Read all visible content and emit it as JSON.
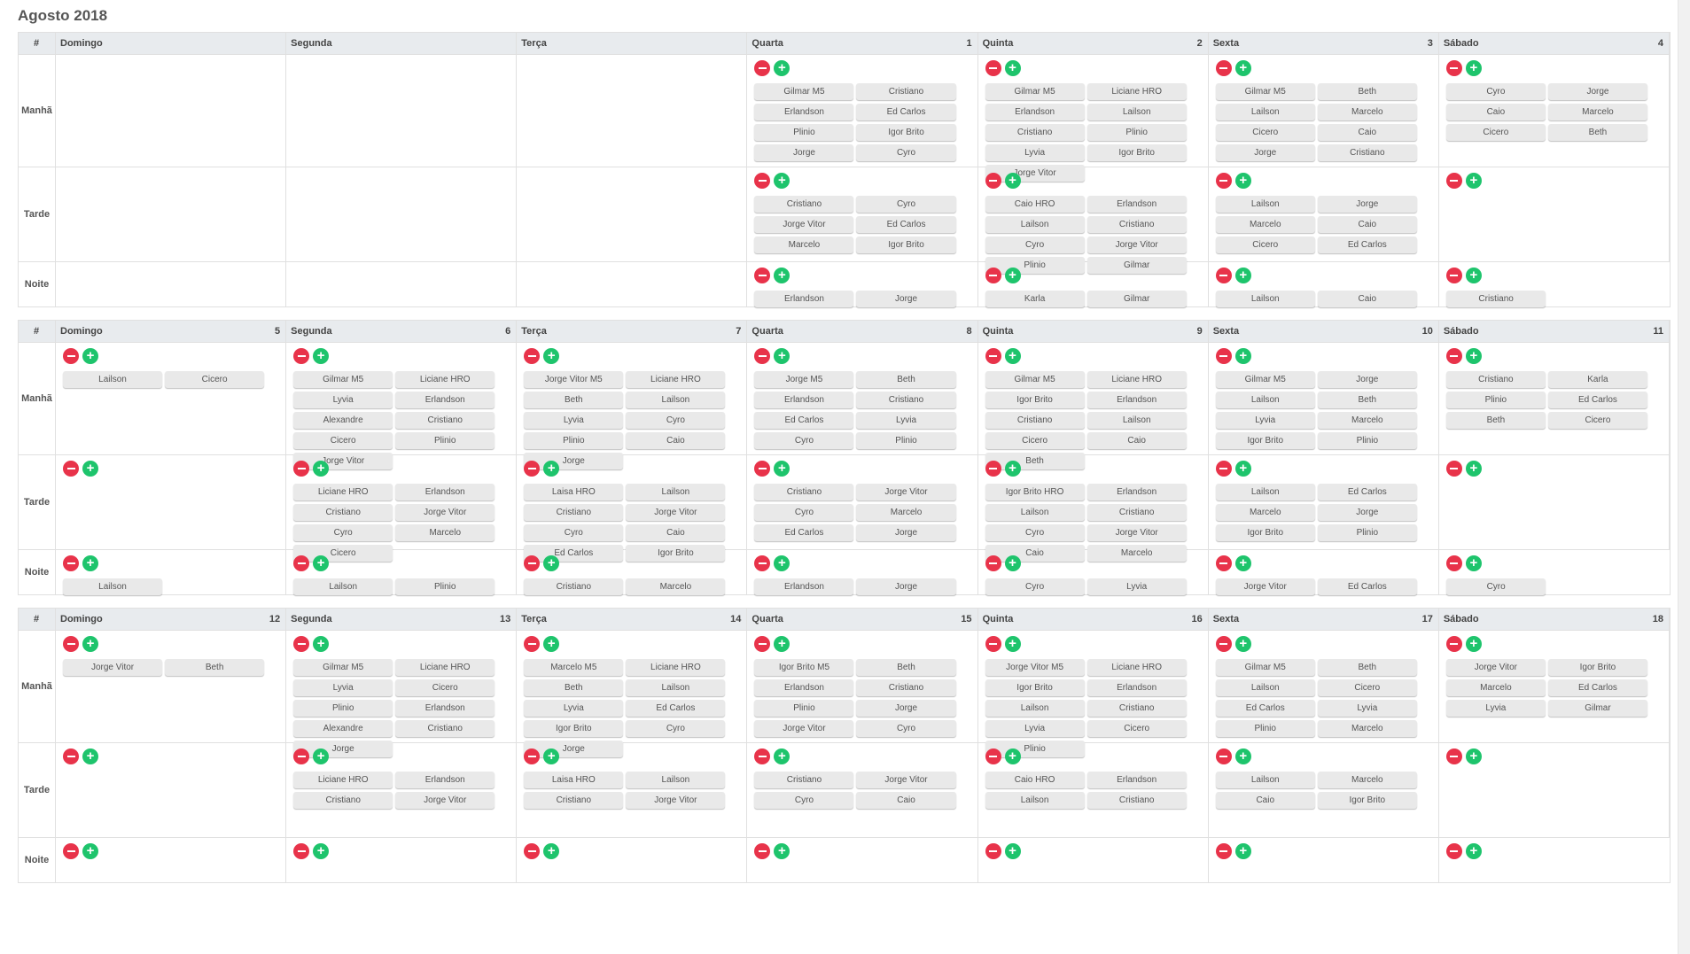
{
  "page_title": "Agosto 2018",
  "hash_label": "#",
  "shift_labels": [
    "Manhã",
    "Tarde",
    "Noite"
  ],
  "day_names": [
    "Domingo",
    "Segunda",
    "Terça",
    "Quarta",
    "Quinta",
    "Sexta",
    "Sábado"
  ],
  "weeks": [
    {
      "days": [
        {
          "num": "",
          "slots": [
            null,
            null,
            null
          ]
        },
        {
          "num": "",
          "slots": [
            null,
            null,
            null
          ]
        },
        {
          "num": "",
          "slots": [
            null,
            null,
            null
          ]
        },
        {
          "num": "1",
          "slots": [
            [
              "Gilmar M5",
              "Cristiano",
              "Erlandson",
              "Ed Carlos",
              "Plinio",
              "Igor Brito",
              "Jorge",
              "Cyro"
            ],
            [
              "Cristiano",
              "Cyro",
              "Jorge Vitor",
              "Ed Carlos",
              "Marcelo",
              "Igor Brito"
            ],
            [
              "Erlandson",
              "Jorge"
            ]
          ]
        },
        {
          "num": "2",
          "slots": [
            [
              "Gilmar M5",
              "Liciane HRO",
              "Erlandson",
              "Lailson",
              "Cristiano",
              "Plinio",
              "Lyvia",
              "Igor Brito",
              "Jorge Vitor"
            ],
            [
              "Caio HRO",
              "Erlandson",
              "Lailson",
              "Cristiano",
              "Cyro",
              "Jorge Vitor",
              "Plinio",
              "Gilmar"
            ],
            [
              "Karla",
              "Gilmar"
            ]
          ]
        },
        {
          "num": "3",
          "slots": [
            [
              "Gilmar M5",
              "Beth",
              "Lailson",
              "Marcelo",
              "Cicero",
              "Caio",
              "Jorge",
              "Cristiano"
            ],
            [
              "Lailson",
              "Jorge",
              "Marcelo",
              "Caio",
              "Cicero",
              "Ed Carlos"
            ],
            [
              "Lailson",
              "Caio"
            ]
          ]
        },
        {
          "num": "4",
          "slots": [
            [
              "Cyro",
              "Jorge",
              "Caio",
              "Marcelo",
              "Cicero",
              "Beth"
            ],
            [],
            [
              "Cristiano"
            ]
          ]
        }
      ]
    },
    {
      "days": [
        {
          "num": "5",
          "slots": [
            [
              "Lailson",
              "Cicero"
            ],
            [],
            [
              "Lailson"
            ]
          ]
        },
        {
          "num": "6",
          "slots": [
            [
              "Gilmar M5",
              "Liciane HRO",
              "Lyvia",
              "Erlandson",
              "Alexandre",
              "Cristiano",
              "Cicero",
              "Plinio",
              "Jorge Vitor"
            ],
            [
              "Liciane HRO",
              "Erlandson",
              "Cristiano",
              "Jorge Vitor",
              "Cyro",
              "Marcelo",
              "Cicero"
            ],
            [
              "Lailson",
              "Plinio"
            ]
          ]
        },
        {
          "num": "7",
          "slots": [
            [
              "Jorge Vitor M5",
              "Liciane HRO",
              "Beth",
              "Lailson",
              "Lyvia",
              "Cyro",
              "Plinio",
              "Caio",
              "Jorge"
            ],
            [
              "Laisa HRO",
              "Lailson",
              "Cristiano",
              "Jorge Vitor",
              "Cyro",
              "Caio",
              "Ed Carlos",
              "Igor Brito"
            ],
            [
              "Cristiano",
              "Marcelo"
            ]
          ]
        },
        {
          "num": "8",
          "slots": [
            [
              "Jorge M5",
              "Beth",
              "Erlandson",
              "Cristiano",
              "Ed Carlos",
              "Lyvia",
              "Cyro",
              "Plinio"
            ],
            [
              "Cristiano",
              "Jorge Vitor",
              "Cyro",
              "Marcelo",
              "Ed Carlos",
              "Jorge"
            ],
            [
              "Erlandson",
              "Jorge"
            ]
          ]
        },
        {
          "num": "9",
          "slots": [
            [
              "Gilmar M5",
              "Liciane HRO",
              "Igor Brito",
              "Erlandson",
              "Cristiano",
              "Lailson",
              "Cicero",
              "Caio",
              "Beth"
            ],
            [
              "Igor Brito HRO",
              "Erlandson",
              "Lailson",
              "Cristiano",
              "Cyro",
              "Jorge Vitor",
              "Caio",
              "Marcelo"
            ],
            [
              "Cyro",
              "Lyvia"
            ]
          ]
        },
        {
          "num": "10",
          "slots": [
            [
              "Gilmar M5",
              "Jorge",
              "Lailson",
              "Beth",
              "Lyvia",
              "Marcelo",
              "Igor Brito",
              "Plinio"
            ],
            [
              "Lailson",
              "Ed Carlos",
              "Marcelo",
              "Jorge",
              "Igor Brito",
              "Plinio"
            ],
            [
              "Jorge Vitor",
              "Ed Carlos"
            ]
          ]
        },
        {
          "num": "11",
          "slots": [
            [
              "Cristiano",
              "Karla",
              "Plinio",
              "Ed Carlos",
              "Beth",
              "Cicero"
            ],
            [],
            [
              "Cyro"
            ]
          ]
        }
      ]
    },
    {
      "days": [
        {
          "num": "12",
          "slots": [
            [
              "Jorge Vitor",
              "Beth"
            ],
            [],
            []
          ]
        },
        {
          "num": "13",
          "slots": [
            [
              "Gilmar M5",
              "Liciane HRO",
              "Lyvia",
              "Cicero",
              "Plinio",
              "Erlandson",
              "Alexandre",
              "Cristiano",
              "Jorge"
            ],
            [
              "Liciane HRO",
              "Erlandson",
              "Cristiano",
              "Jorge Vitor"
            ],
            []
          ]
        },
        {
          "num": "14",
          "slots": [
            [
              "Marcelo M5",
              "Liciane HRO",
              "Beth",
              "Lailson",
              "Lyvia",
              "Ed Carlos",
              "Igor Brito",
              "Cyro",
              "Jorge"
            ],
            [
              "Laisa HRO",
              "Lailson",
              "Cristiano",
              "Jorge Vitor"
            ],
            []
          ]
        },
        {
          "num": "15",
          "slots": [
            [
              "Igor Brito M5",
              "Beth",
              "Erlandson",
              "Cristiano",
              "Plinio",
              "Jorge",
              "Jorge Vitor",
              "Cyro"
            ],
            [
              "Cristiano",
              "Jorge Vitor",
              "Cyro",
              "Caio"
            ],
            []
          ]
        },
        {
          "num": "16",
          "slots": [
            [
              "Jorge Vitor M5",
              "Liciane HRO",
              "Igor Brito",
              "Erlandson",
              "Lailson",
              "Cristiano",
              "Lyvia",
              "Cicero",
              "Plinio"
            ],
            [
              "Caio HRO",
              "Erlandson",
              "Lailson",
              "Cristiano"
            ],
            []
          ]
        },
        {
          "num": "17",
          "slots": [
            [
              "Gilmar M5",
              "Beth",
              "Lailson",
              "Cicero",
              "Ed Carlos",
              "Lyvia",
              "Plinio",
              "Marcelo"
            ],
            [
              "Lailson",
              "Marcelo",
              "Caio",
              "Igor Brito"
            ],
            []
          ]
        },
        {
          "num": "18",
          "slots": [
            [
              "Jorge Vitor",
              "Igor Brito",
              "Marcelo",
              "Ed Carlos",
              "Lyvia",
              "Gilmar"
            ],
            [],
            []
          ]
        }
      ]
    }
  ]
}
